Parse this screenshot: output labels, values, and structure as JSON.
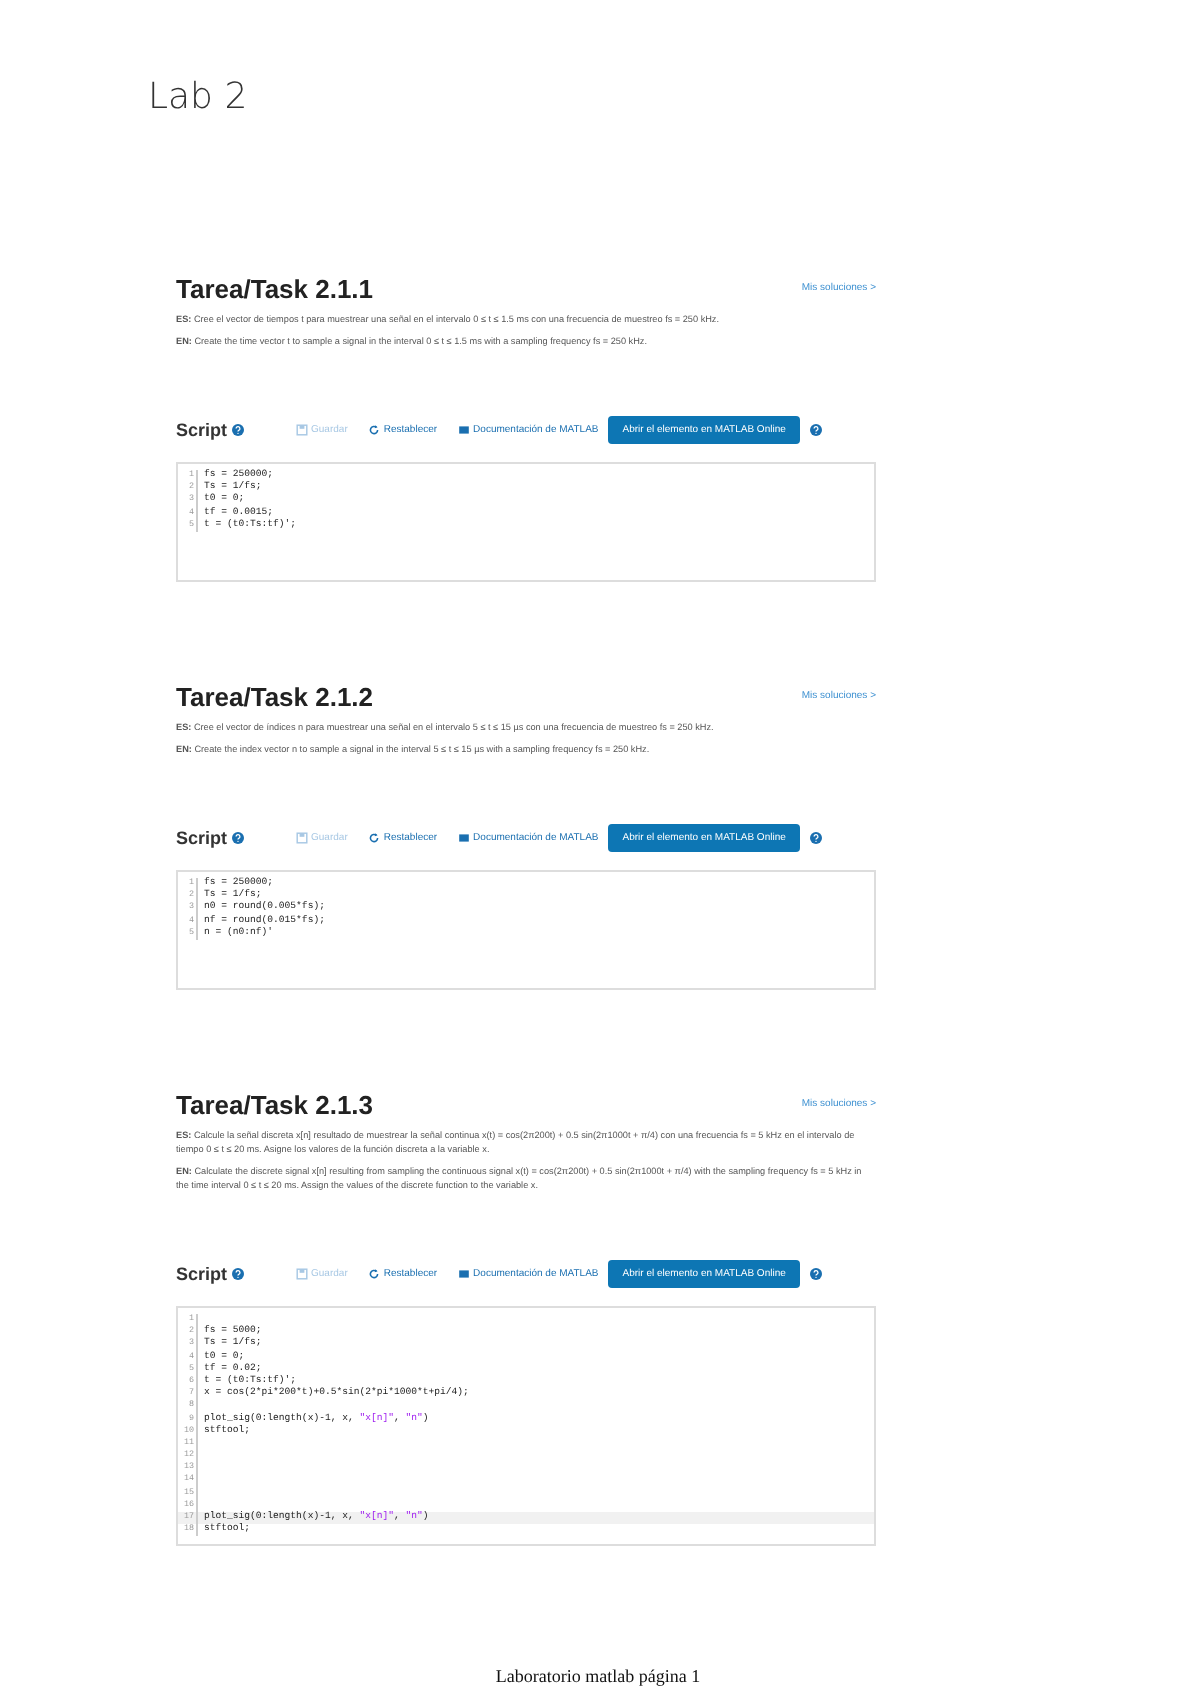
{
  "page_title": "Lab 2",
  "tasks": [
    {
      "title": "Tarea/Task 2.1.1",
      "link": "Mis soluciones >",
      "paragraphs": [
        "**ES:** Cree el vector de tiempos t para muestrear una señal en el intervalo 0 ≤ t ≤ 1.5 ms con una frecuencia de muestreo fs = 250 kHz.",
        "**EN:** Create the time vector t to sample a signal in the interval 0 ≤ t ≤ 1.5 ms with a sampling frequency fs = 250 kHz."
      ],
      "toolbar": {
        "label": "Script",
        "save": {
          "text": "Guardar",
          "disabled": true
        },
        "reset": "Restablecer",
        "docs": "Documentación de MATLAB",
        "open": "Abrir el elemento en MATLAB Online"
      },
      "code_lines": [
        {
          "n": "1",
          "code": "fs = 250000;",
          "current": false
        },
        {
          "n": "2",
          "code": "Ts = 1/fs;",
          "current": false
        },
        {
          "n": "3",
          "code": "t0 = 0;",
          "current": false
        },
        {
          "n": "4",
          "code": "tf = 0.0015;",
          "current": false
        },
        {
          "n": "5",
          "code": "t = (t0:Ts:tf)';",
          "current": false
        }
      ]
    },
    {
      "title": "Tarea/Task 2.1.2",
      "link": "Mis soluciones >",
      "paragraphs": [
        "**ES:** Cree el vector de índices n para muestrear una señal en el intervalo 5 ≤ t ≤ 15 µs con una frecuencia de muestreo fs = 250 kHz.",
        "**EN:** Create the index vector n to sample a signal in the interval 5 ≤ t ≤ 15 µs with a sampling frequency fs = 250 kHz."
      ],
      "toolbar": {
        "label": "Script",
        "save": {
          "text": "Guardar",
          "disabled": true
        },
        "reset": "Restablecer",
        "docs": "Documentación de MATLAB",
        "open": "Abrir el elemento en MATLAB Online"
      },
      "code_lines": [
        {
          "n": "1",
          "code": "fs = 250000;",
          "current": false
        },
        {
          "n": "2",
          "code": "Ts = 1/fs;",
          "current": false
        },
        {
          "n": "3",
          "code": "n0 = round(0.005*fs);",
          "current": false
        },
        {
          "n": "4",
          "code": "nf = round(0.015*fs);",
          "current": false
        },
        {
          "n": "5",
          "code": "n = (n0:nf)'",
          "current": false
        }
      ]
    },
    {
      "title": "Tarea/Task 2.1.3",
      "link": "Mis soluciones >",
      "paragraphs": [
        "**ES:** Calcule la señal discreta x[n] resultado de muestrear la señal continua x(t) = cos(2π200t) + 0.5 sin(2π1000t + π/4) con una frecuencia fs = 5 kHz en el intervalo de tiempo 0 ≤ t ≤ 20 ms. Asigne los valores de la función discreta a la variable x.",
        "**EN:** Calculate the discrete signal x[n] resulting from sampling the continuous signal x(t) = cos(2π200t) + 0.5 sin(2π1000t + π/4) with the sampling frequency fs = 5 kHz in the time interval 0 ≤ t ≤ 20 ms. Assign the values of the discrete function to the variable x."
      ],
      "toolbar": {
        "label": "Script",
        "save": {
          "text": "Guardar",
          "disabled": true
        },
        "reset": "Restablecer",
        "docs": "Documentación de MATLAB",
        "open": "Abrir el elemento en MATLAB Online"
      },
      "code_lines": [
        {
          "n": "1",
          "current": false
        },
        {
          "n": "2",
          "code": "fs = 5000;",
          "current": false
        },
        {
          "n": "3",
          "code": "Ts = 1/fs;",
          "current": false
        },
        {
          "n": "4",
          "code": "t0 = 0;",
          "current": false
        },
        {
          "n": "5",
          "code": "tf = 0.02;",
          "current": false
        },
        {
          "n": "6",
          "code": "t = (t0:Ts:tf)';",
          "current": false
        },
        {
          "n": "7",
          "code": "x = cos(2*pi*200*t)+0.5*sin(2*pi*1000*t+pi/4);",
          "current": false
        },
        {
          "n": "8",
          "current": false
        },
        {
          "n": "9",
          "code": "plot_sig(0:length(x)-1, x, \"x[n]\", \"n\")",
          "current": false
        },
        {
          "n": "10",
          "code": "stftool;",
          "current": false
        },
        {
          "n": "11",
          "current": false
        },
        {
          "n": "12",
          "current": false
        },
        {
          "n": "13",
          "current": false
        },
        {
          "n": "14",
          "current": false
        },
        {
          "n": "15",
          "current": false
        },
        {
          "n": "16",
          "current": false
        },
        {
          "n": "17",
          "code": "plot_sig(0:length(x)-1, x, \"x[n]\", \"n\")",
          "current": true
        },
        {
          "n": "18",
          "code": "stftool;",
          "current": false
        }
      ]
    }
  ],
  "footer": "Laboratorio matlab página 1"
}
